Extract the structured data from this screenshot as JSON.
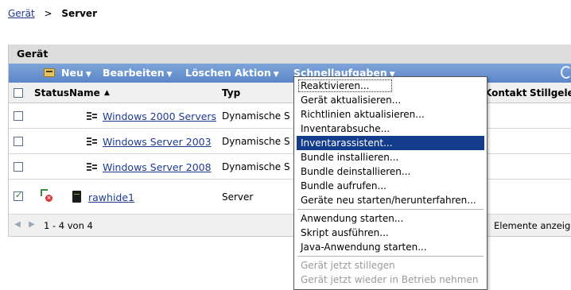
{
  "breadcrumb": {
    "parent": "Gerät",
    "separator": ">",
    "current": "Server"
  },
  "panel": {
    "title": "Gerät"
  },
  "toolbar": {
    "new": "Neu",
    "edit": "Bearbeiten",
    "delete": "Löschen",
    "action": "Aktion",
    "quick_tasks": "Schnellaufgaben"
  },
  "table": {
    "headers": {
      "status": "Status",
      "name": "Name",
      "type": "Typ",
      "contact": "Kontakt",
      "retired": "Stillgeleg"
    },
    "sort_indicator": "▲",
    "rows": [
      {
        "name": "Windows 2000 Servers",
        "type": "Dynamische S",
        "checked": false
      },
      {
        "name": "Windows Server 2003",
        "type": "Dynamische S",
        "checked": false
      },
      {
        "name": "Windows Server 2008",
        "type": "Dynamische S",
        "checked": false
      },
      {
        "name": "rawhide1",
        "type": "Server",
        "checked": true
      }
    ]
  },
  "footer": {
    "prev": "◀",
    "next": "▶",
    "range": "1 - 4 von 4",
    "show_items": "Elemente anzeigen"
  },
  "menu": {
    "items": [
      {
        "label": "Reaktivieren...",
        "state": "focused"
      },
      {
        "label": "Gerät aktualisieren...",
        "state": "normal"
      },
      {
        "label": "Richtlinien aktualisieren...",
        "state": "normal"
      },
      {
        "label": "Inventarabsuche...",
        "state": "normal"
      },
      {
        "label": "Inventarassistent...",
        "state": "highlighted"
      },
      {
        "label": "Bundle installieren...",
        "state": "normal"
      },
      {
        "label": "Bundle deinstallieren...",
        "state": "normal"
      },
      {
        "label": "Bundle aufrufen...",
        "state": "normal"
      },
      {
        "label": "Geräte neu starten/herunterfahren...",
        "state": "normal"
      },
      {
        "label": "Anwendung starten...",
        "state": "normal"
      },
      {
        "label": "Skript ausführen...",
        "state": "normal"
      },
      {
        "label": "Java-Anwendung starten...",
        "state": "normal"
      },
      {
        "label": "Gerät jetzt stillegen",
        "state": "disabled"
      },
      {
        "label": "Gerät jetzt wieder in Betrieb nehmen",
        "state": "disabled"
      }
    ]
  },
  "colors": {
    "toolbar": "#5b86c8",
    "highlight": "#143c8c",
    "link": "#1f3a93",
    "header_bg": "#dcdcdc"
  },
  "icons": {
    "new": "folder-icon",
    "refresh": "refresh-icon",
    "device_group": "device-group-icon",
    "server": "server-icon",
    "status": "status-error-icon"
  }
}
